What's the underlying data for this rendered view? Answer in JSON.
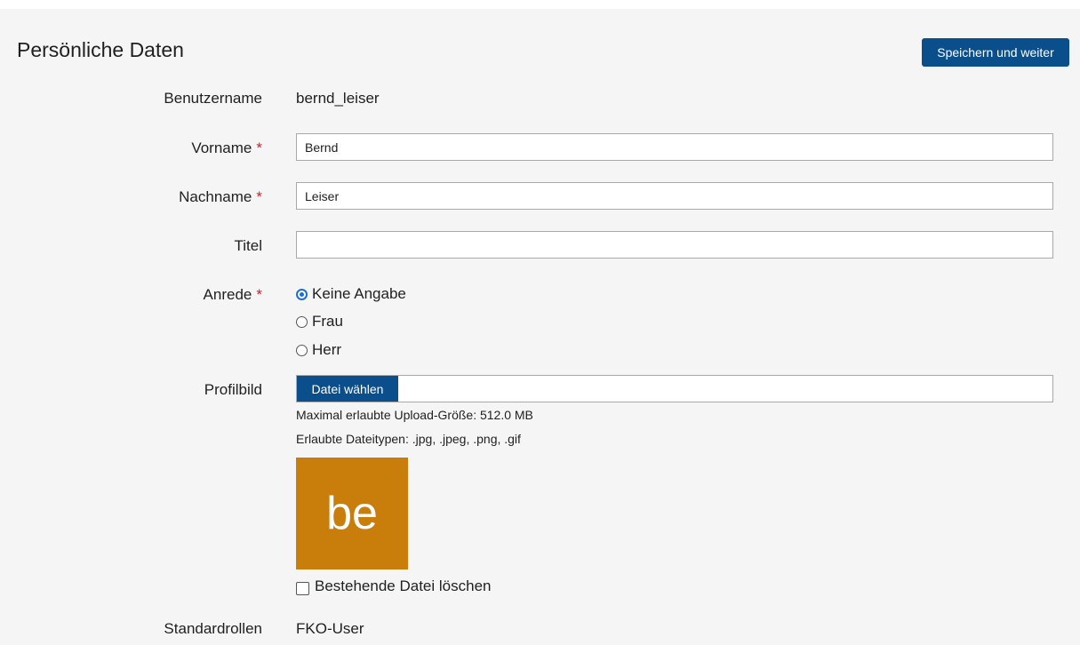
{
  "page": {
    "title": "Persönliche Daten",
    "save_button": "Speichern und weiter"
  },
  "fields": {
    "username": {
      "label": "Benutzername",
      "value": "bernd_leiser"
    },
    "firstname": {
      "label": "Vorname",
      "required_mark": "*",
      "value": "Bernd"
    },
    "lastname": {
      "label": "Nachname",
      "required_mark": "*",
      "value": "Leiser"
    },
    "title": {
      "label": "Titel",
      "value": ""
    },
    "salutation": {
      "label": "Anrede",
      "required_mark": "*",
      "options": [
        "Keine Angabe",
        "Frau",
        "Herr"
      ],
      "selected": "Keine Angabe"
    },
    "profile_image": {
      "label": "Profilbild",
      "choose_button": "Datei wählen",
      "max_size_hint": "Maximal erlaubte Upload-Größe: 512.0 MB",
      "types_hint": "Erlaubte Dateitypen: .jpg, .jpeg, .png, .gif",
      "avatar_initials": "be",
      "avatar_color": "#c97e0c",
      "delete_label": "Bestehende Datei löschen",
      "delete_checked": false
    },
    "default_roles": {
      "label": "Standardrollen",
      "value": "FKO-User"
    }
  },
  "colors": {
    "primary": "#0b4e8c",
    "required": "#c0272d",
    "radio_selected": "#1a6fd6",
    "panel_background": "#f5f5f5"
  }
}
